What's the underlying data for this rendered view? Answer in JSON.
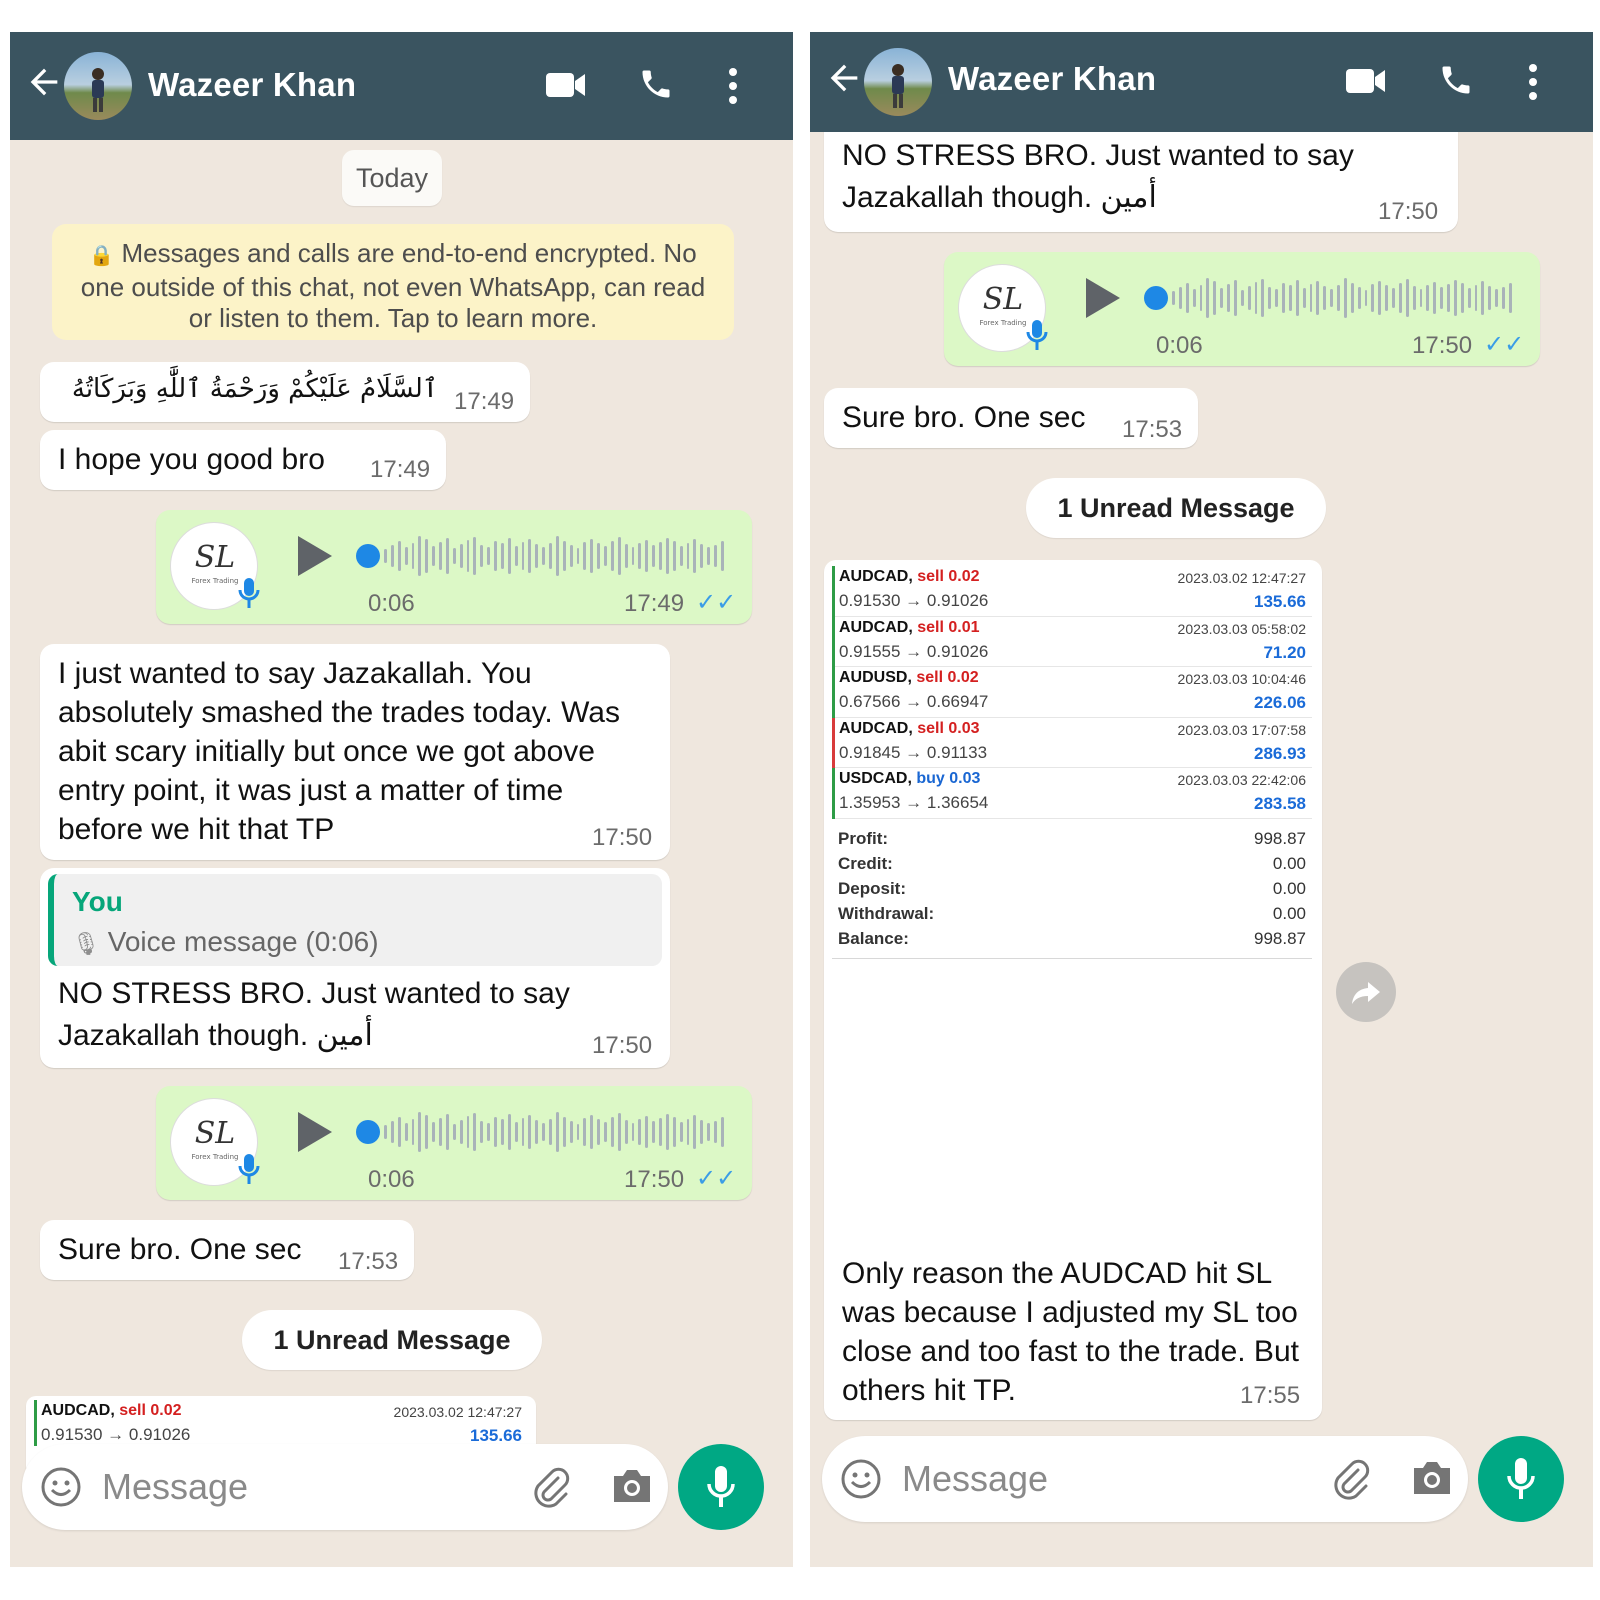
{
  "contact_name": "Wazeer Khan",
  "input_placeholder": "Message",
  "left": {
    "date_chip": "Today",
    "encryption_notice": "Messages and calls are end-to-end encrypted. No one outside of this chat, not even WhatsApp, can read or listen to them. Tap to learn more.",
    "msg1": {
      "text": "ٱلسَّلَامُ عَلَيْكُمْ وَرَحْمَةُ ٱللَّٰهِ وَبَرَكَاتُهُ",
      "time": "17:49"
    },
    "msg2": {
      "text": "I hope you good bro",
      "time": "17:49"
    },
    "voice1": {
      "duration": "0:06",
      "time": "17:49",
      "ticks": "✓✓"
    },
    "msg3": {
      "text": "I just wanted to say Jazakallah. You absolutely smashed the trades today. Was abit scary initially but once we got above entry point, it was just a matter of time before we hit that TP",
      "time": "17:50"
    },
    "reply": {
      "author": "You",
      "quoted": "Voice message (0:06)",
      "text_line1": "NO STRESS BRO. Just wanted to say",
      "text_line2": "Jazakallah though.  أمين",
      "time": "17:50"
    },
    "voice2": {
      "duration": "0:06",
      "time": "17:50",
      "ticks": "✓✓"
    },
    "msg4": {
      "text": "Sure bro. One sec",
      "time": "17:53"
    },
    "unread": "1 Unread Message",
    "peek": {
      "symbol": "AUDCAD,",
      "side": "sell 0.02",
      "date": "2023.03.02 12:47:27",
      "price": "0.91530 → 0.91026",
      "profit": "135.66"
    }
  },
  "right": {
    "top_msg": {
      "text_line1": "NO STRESS BRO. Just wanted to say",
      "text_line2": "Jazakallah though.  أمين",
      "time": "17:50"
    },
    "voice": {
      "duration": "0:06",
      "time": "17:50",
      "ticks": "✓✓"
    },
    "msg": {
      "text": "Sure bro. One sec",
      "time": "17:53"
    },
    "unread": "1 Unread Message",
    "trades": [
      {
        "symbol": "AUDCAD,",
        "side": "sell 0.02",
        "date": "2023.03.02 12:47:27",
        "price": "0.91530 → 0.91026",
        "profit": "135.66"
      },
      {
        "symbol": "AUDCAD,",
        "side": "sell 0.01",
        "date": "2023.03.03 05:58:02",
        "price": "0.91555 → 0.91026",
        "profit": "71.20"
      },
      {
        "symbol": "AUDUSD,",
        "side": "sell 0.02",
        "date": "2023.03.03 10:04:46",
        "price": "0.67566 → 0.66947",
        "profit": "226.06"
      },
      {
        "symbol": "AUDCAD,",
        "side": "sell 0.03",
        "date": "2023.03.03 17:07:58",
        "price": "0.91845 → 0.91133",
        "profit": "286.93"
      },
      {
        "symbol": "USDCAD,",
        "side": "buy 0.03",
        "date": "2023.03.03 22:42:06",
        "price": "1.35953 → 1.36654",
        "profit": "283.58"
      }
    ],
    "summary": [
      {
        "label": "Profit:",
        "value": "998.87"
      },
      {
        "label": "Credit:",
        "value": "0.00"
      },
      {
        "label": "Deposit:",
        "value": "0.00"
      },
      {
        "label": "Withdrawal:",
        "value": "0.00"
      },
      {
        "label": "Balance:",
        "value": "998.87"
      }
    ],
    "caption": {
      "text": "Only reason the AUDCAD hit SL was because I adjusted my SL too close and too fast to the trade. But others hit TP.",
      "time": "17:55"
    }
  },
  "colors": {
    "header": "#3a5460",
    "outgoing": "#dcf8c6",
    "chat_bg": "#efe7de",
    "accent": "#00a884",
    "tick": "#3b9de6"
  }
}
